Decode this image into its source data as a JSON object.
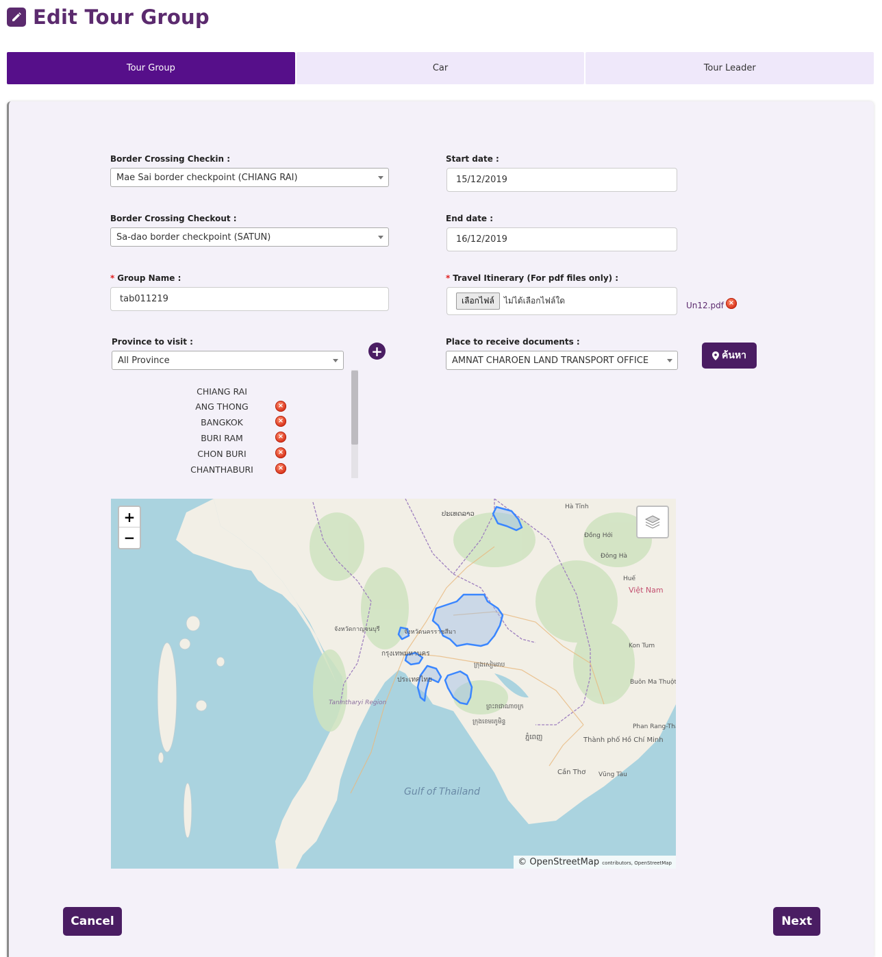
{
  "page": {
    "title": "Edit Tour Group"
  },
  "tabs": [
    {
      "label": "Tour Group",
      "active": true
    },
    {
      "label": "Car",
      "active": false
    },
    {
      "label": "Tour Leader",
      "active": false
    }
  ],
  "form": {
    "checkin": {
      "label": "Border Crossing Checkin :",
      "value": "Mae Sai border checkpoint (CHIANG RAI)"
    },
    "checkout": {
      "label": "Border Crossing Checkout :",
      "value": "Sa-dao border checkpoint (SATUN)"
    },
    "start_date": {
      "label": "Start date :",
      "value": "15/12/2019"
    },
    "end_date": {
      "label": "End date :",
      "value": "16/12/2019"
    },
    "group_name": {
      "required_mark": "*",
      "label": "Group Name :",
      "value": "tab011219"
    },
    "itinerary": {
      "required_mark": "*",
      "label": "Travel Itinerary (For pdf files only) :",
      "choose_button": "เลือกไฟล์",
      "no_file_text": "ไม่ได้เลือกไฟล์ใด",
      "uploaded_file": "Un12.pdf"
    },
    "province": {
      "label": "Province to visit :",
      "value": "All Province"
    },
    "documents_place": {
      "label": "Place to receive documents :",
      "value": "AMNAT CHAROEN LAND TRANSPORT OFFICE"
    },
    "search_button": "ค้นหา"
  },
  "province_list": [
    "CHIANG RAI",
    "ANG THONG",
    "BANGKOK",
    "BURI RAM",
    "CHON BURI",
    "CHANTHABURI"
  ],
  "map": {
    "zoom_in": "+",
    "zoom_out": "−",
    "attribution_main": "OpenStreetMap",
    "attribution_small": "contributors, OpenStreetMap",
    "labels": {
      "gulf": "Gulf of Thailand",
      "vietnam": "Việt Nam",
      "hcm": "Thành phố Hồ Chí Minh",
      "bangkok": "กรุงเทพมหานคร",
      "phnompenh": "ភ្នំពេញ",
      "tanintharyi": "Tanintharyi Region",
      "hatinh": "Hà Tĩnh",
      "donghoi": "Đồng Hới",
      "hue": "Huế",
      "kontum": "Kon Tum",
      "cantho": "Cần Thơ",
      "vungtau": "Vũng Tàu",
      "buonmathuot": "Buôn Ma Thuột",
      "phanrang": "Phan Rang-Tháp Chàm",
      "dongha": "Đông Hà"
    }
  },
  "buttons": {
    "cancel": "Cancel",
    "next": "Next"
  },
  "colors": {
    "primary": "#560f8a",
    "button": "#4a1d63",
    "title": "#5b2a6e",
    "tab_inactive": "#efe8fa",
    "panel": "#f4f1f9",
    "remove": "#d8321a"
  }
}
